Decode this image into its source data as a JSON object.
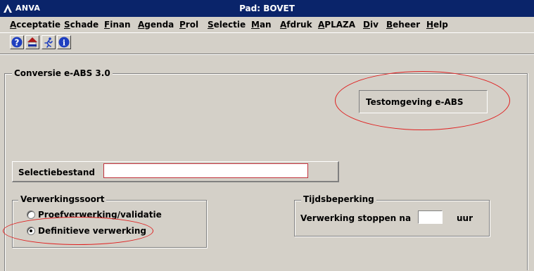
{
  "window": {
    "app_name": "ANVA",
    "title": "Pad: BOVET"
  },
  "menu": [
    "Acceptatie",
    "Schade",
    "Finan",
    "Agenda",
    "Prol",
    "Selectie",
    "Man",
    "Afdruk",
    "APLAZA",
    "Div",
    "Beheer",
    "Help"
  ],
  "toolbar": {
    "icons": [
      "help-icon",
      "anva-home-icon",
      "runner-icon",
      "info-icon"
    ]
  },
  "panel": {
    "title": "Conversie e-ABS 3.0",
    "test_env_label": "Testomgeving e-ABS"
  },
  "selection": {
    "label": "Selectiebestand",
    "value": ""
  },
  "processing_type": {
    "title": "Verwerkingssoort",
    "options": [
      {
        "label": "Proefverwerking/validatie",
        "checked": false
      },
      {
        "label": "Definitieve verwerking",
        "checked": true
      }
    ]
  },
  "time_limit": {
    "title": "Tijdsbeperking",
    "label": "Verwerking stoppen na",
    "value": "",
    "unit": "uur"
  },
  "highlight_color": "#e02020"
}
